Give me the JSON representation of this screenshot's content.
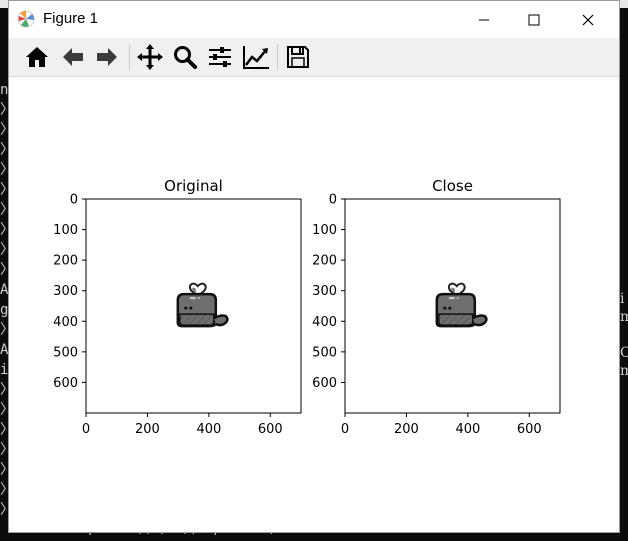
{
  "window": {
    "title": "Figure 1"
  },
  "toolbar": {
    "tools": [
      {
        "name": "home-icon"
      },
      {
        "name": "arrow-left-icon"
      },
      {
        "name": "arrow-right-icon"
      },
      {
        "name": "move-icon"
      },
      {
        "name": "zoom-icon"
      },
      {
        "name": "sliders-icon"
      },
      {
        "name": "chart-line-icon"
      },
      {
        "name": "save-icon"
      }
    ]
  },
  "subplots": [
    {
      "title": "Original",
      "xticks": [
        "0",
        "200",
        "400",
        "600"
      ],
      "yticks": [
        "0",
        "100",
        "200",
        "300",
        "400",
        "500",
        "600"
      ]
    },
    {
      "title": "Close",
      "xticks": [
        "0",
        "200",
        "400",
        "600"
      ],
      "yticks": [
        "0",
        "100",
        "200",
        "300",
        "400",
        "500",
        "600"
      ]
    }
  ],
  "background": {
    "left_glyphs": [
      "n",
      "〉",
      "〉",
      "〉",
      "〉",
      "〉",
      "〉",
      "〉",
      "〉",
      "〉",
      "A",
      "g",
      "〉",
      "A",
      "i",
      "〉",
      "〉",
      "〉",
      "〉",
      "〉",
      "〉",
      "〉"
    ],
    "right_glyphs": [
      "i",
      "m",
      "",
      "O",
      "m"
    ],
    "bottom_text": "kernel = np.ones((5, 5), np.uint8)"
  }
}
